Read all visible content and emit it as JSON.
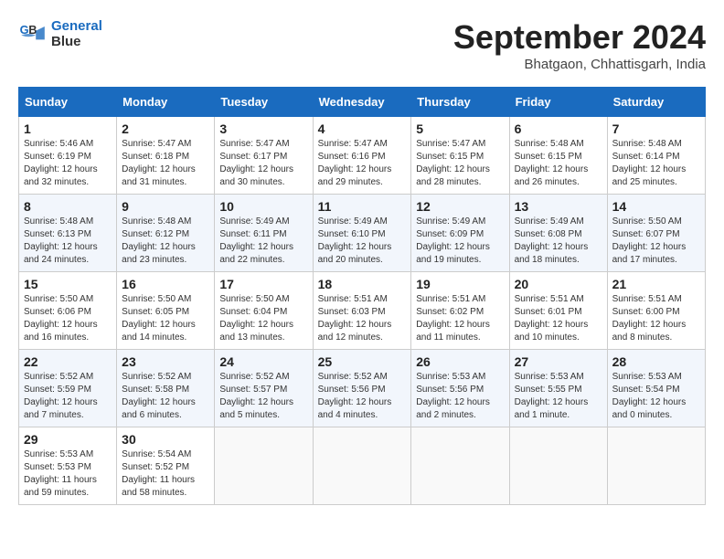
{
  "logo": {
    "line1": "General",
    "line2": "Blue"
  },
  "title": "September 2024",
  "location": "Bhatgaon, Chhattisgarh, India",
  "days_of_week": [
    "Sunday",
    "Monday",
    "Tuesday",
    "Wednesday",
    "Thursday",
    "Friday",
    "Saturday"
  ],
  "weeks": [
    [
      {
        "day": "1",
        "info": "Sunrise: 5:46 AM\nSunset: 6:19 PM\nDaylight: 12 hours\nand 32 minutes."
      },
      {
        "day": "2",
        "info": "Sunrise: 5:47 AM\nSunset: 6:18 PM\nDaylight: 12 hours\nand 31 minutes."
      },
      {
        "day": "3",
        "info": "Sunrise: 5:47 AM\nSunset: 6:17 PM\nDaylight: 12 hours\nand 30 minutes."
      },
      {
        "day": "4",
        "info": "Sunrise: 5:47 AM\nSunset: 6:16 PM\nDaylight: 12 hours\nand 29 minutes."
      },
      {
        "day": "5",
        "info": "Sunrise: 5:47 AM\nSunset: 6:15 PM\nDaylight: 12 hours\nand 28 minutes."
      },
      {
        "day": "6",
        "info": "Sunrise: 5:48 AM\nSunset: 6:15 PM\nDaylight: 12 hours\nand 26 minutes."
      },
      {
        "day": "7",
        "info": "Sunrise: 5:48 AM\nSunset: 6:14 PM\nDaylight: 12 hours\nand 25 minutes."
      }
    ],
    [
      {
        "day": "8",
        "info": "Sunrise: 5:48 AM\nSunset: 6:13 PM\nDaylight: 12 hours\nand 24 minutes."
      },
      {
        "day": "9",
        "info": "Sunrise: 5:48 AM\nSunset: 6:12 PM\nDaylight: 12 hours\nand 23 minutes."
      },
      {
        "day": "10",
        "info": "Sunrise: 5:49 AM\nSunset: 6:11 PM\nDaylight: 12 hours\nand 22 minutes."
      },
      {
        "day": "11",
        "info": "Sunrise: 5:49 AM\nSunset: 6:10 PM\nDaylight: 12 hours\nand 20 minutes."
      },
      {
        "day": "12",
        "info": "Sunrise: 5:49 AM\nSunset: 6:09 PM\nDaylight: 12 hours\nand 19 minutes."
      },
      {
        "day": "13",
        "info": "Sunrise: 5:49 AM\nSunset: 6:08 PM\nDaylight: 12 hours\nand 18 minutes."
      },
      {
        "day": "14",
        "info": "Sunrise: 5:50 AM\nSunset: 6:07 PM\nDaylight: 12 hours\nand 17 minutes."
      }
    ],
    [
      {
        "day": "15",
        "info": "Sunrise: 5:50 AM\nSunset: 6:06 PM\nDaylight: 12 hours\nand 16 minutes."
      },
      {
        "day": "16",
        "info": "Sunrise: 5:50 AM\nSunset: 6:05 PM\nDaylight: 12 hours\nand 14 minutes."
      },
      {
        "day": "17",
        "info": "Sunrise: 5:50 AM\nSunset: 6:04 PM\nDaylight: 12 hours\nand 13 minutes."
      },
      {
        "day": "18",
        "info": "Sunrise: 5:51 AM\nSunset: 6:03 PM\nDaylight: 12 hours\nand 12 minutes."
      },
      {
        "day": "19",
        "info": "Sunrise: 5:51 AM\nSunset: 6:02 PM\nDaylight: 12 hours\nand 11 minutes."
      },
      {
        "day": "20",
        "info": "Sunrise: 5:51 AM\nSunset: 6:01 PM\nDaylight: 12 hours\nand 10 minutes."
      },
      {
        "day": "21",
        "info": "Sunrise: 5:51 AM\nSunset: 6:00 PM\nDaylight: 12 hours\nand 8 minutes."
      }
    ],
    [
      {
        "day": "22",
        "info": "Sunrise: 5:52 AM\nSunset: 5:59 PM\nDaylight: 12 hours\nand 7 minutes."
      },
      {
        "day": "23",
        "info": "Sunrise: 5:52 AM\nSunset: 5:58 PM\nDaylight: 12 hours\nand 6 minutes."
      },
      {
        "day": "24",
        "info": "Sunrise: 5:52 AM\nSunset: 5:57 PM\nDaylight: 12 hours\nand 5 minutes."
      },
      {
        "day": "25",
        "info": "Sunrise: 5:52 AM\nSunset: 5:56 PM\nDaylight: 12 hours\nand 4 minutes."
      },
      {
        "day": "26",
        "info": "Sunrise: 5:53 AM\nSunset: 5:56 PM\nDaylight: 12 hours\nand 2 minutes."
      },
      {
        "day": "27",
        "info": "Sunrise: 5:53 AM\nSunset: 5:55 PM\nDaylight: 12 hours\nand 1 minute."
      },
      {
        "day": "28",
        "info": "Sunrise: 5:53 AM\nSunset: 5:54 PM\nDaylight: 12 hours\nand 0 minutes."
      }
    ],
    [
      {
        "day": "29",
        "info": "Sunrise: 5:53 AM\nSunset: 5:53 PM\nDaylight: 11 hours\nand 59 minutes."
      },
      {
        "day": "30",
        "info": "Sunrise: 5:54 AM\nSunset: 5:52 PM\nDaylight: 11 hours\nand 58 minutes."
      },
      {
        "day": "",
        "info": ""
      },
      {
        "day": "",
        "info": ""
      },
      {
        "day": "",
        "info": ""
      },
      {
        "day": "",
        "info": ""
      },
      {
        "day": "",
        "info": ""
      }
    ]
  ]
}
